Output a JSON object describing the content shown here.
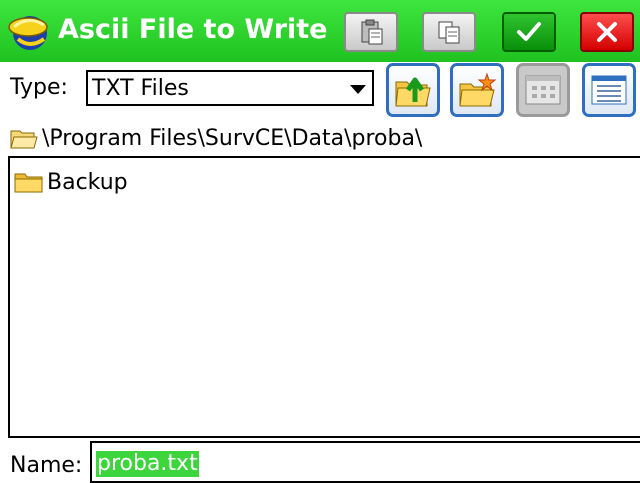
{
  "window": {
    "title": "Ascii File to Write"
  },
  "toolbar": {
    "icons": [
      "paste-icon",
      "copy-icon",
      "checkmark-icon",
      "close-icon"
    ],
    "ok_color": "#1aa81a",
    "cancel_color": "#e60000"
  },
  "type_row": {
    "label": "Type:",
    "selected": "TXT Files",
    "buttons": [
      "folder-up-icon",
      "new-folder-icon",
      "icon-view-icon",
      "list-view-icon"
    ]
  },
  "path": {
    "text": "\\Program Files\\SurvCE\\Data\\proba\\"
  },
  "files": [
    {
      "name": "Backup",
      "icon": "folder-icon"
    }
  ],
  "name_row": {
    "label": "Name:",
    "value": "proba.txt"
  },
  "colors": {
    "titlebar": "#2bd42b",
    "selection": "#3cd63c"
  }
}
